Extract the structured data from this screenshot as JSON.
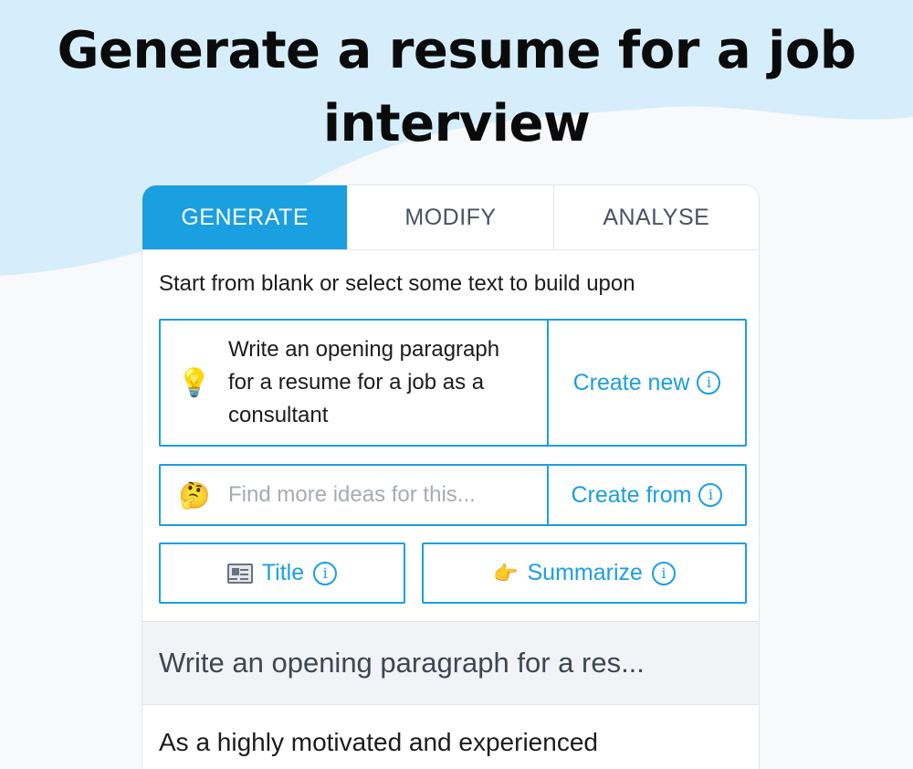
{
  "page": {
    "headline_line1": "Generate a resume for a job",
    "headline_line2": "interview"
  },
  "tabs": [
    {
      "label": "GENERATE",
      "active": true
    },
    {
      "label": "MODIFY",
      "active": false
    },
    {
      "label": "ANALYSE",
      "active": false
    }
  ],
  "generate": {
    "hint": "Start from blank or select some text to build upon",
    "prompt_icon": "lightbulb-icon",
    "prompt_text": "Write an opening paragraph for a resume for a job as a consultant",
    "create_new_label": "Create new",
    "ideas_icon": "thinking-face-icon",
    "ideas_placeholder": "Find more ideas for this...",
    "create_from_label": "Create from",
    "info_glyph": "i",
    "chips": [
      {
        "icon": "newspaper-icon",
        "label": "Title"
      },
      {
        "icon": "pointing-hand-icon",
        "label": "Summarize"
      }
    ]
  },
  "result": {
    "title": "Write an opening paragraph for a res...",
    "body": "As a highly motivated and experienced"
  },
  "colors": {
    "accent": "#1a9fe0",
    "wave": "#d4ecfb",
    "text": "#1c1c1c"
  }
}
